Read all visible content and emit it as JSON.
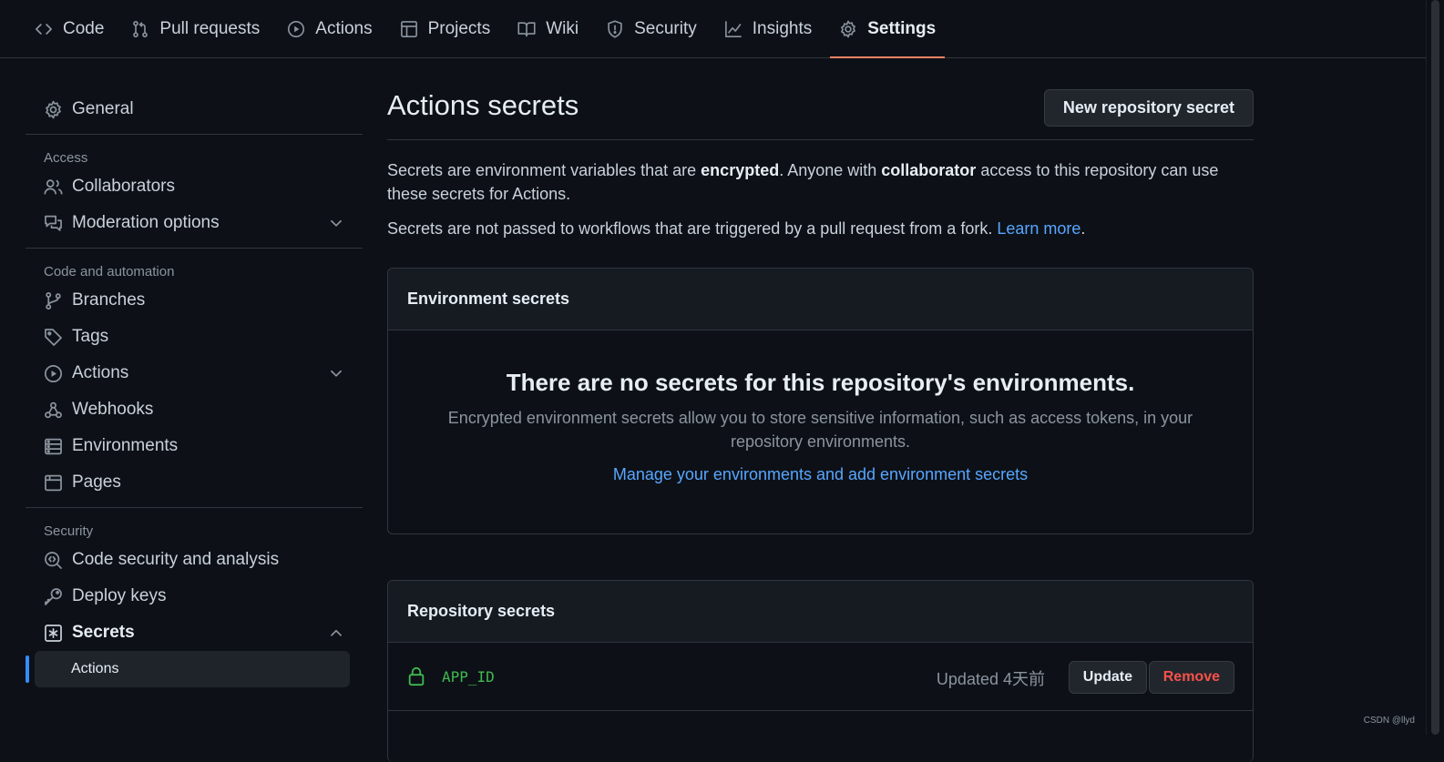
{
  "topnav": {
    "tabs": [
      {
        "label": "Code",
        "icon": "code-icon"
      },
      {
        "label": "Pull requests",
        "icon": "git-pull-request-icon"
      },
      {
        "label": "Actions",
        "icon": "play-circle-icon"
      },
      {
        "label": "Projects",
        "icon": "table-icon"
      },
      {
        "label": "Wiki",
        "icon": "book-icon"
      },
      {
        "label": "Security",
        "icon": "shield-icon"
      },
      {
        "label": "Insights",
        "icon": "graph-icon"
      },
      {
        "label": "Settings",
        "icon": "gear-icon",
        "selected": true
      }
    ]
  },
  "sidebar": {
    "general": "General",
    "access_heading": "Access",
    "collaborators": "Collaborators",
    "moderation": "Moderation options",
    "code_heading": "Code and automation",
    "branches": "Branches",
    "tags": "Tags",
    "actions": "Actions",
    "webhooks": "Webhooks",
    "environments": "Environments",
    "pages": "Pages",
    "security_heading": "Security",
    "code_security": "Code security and analysis",
    "deploy_keys": "Deploy keys",
    "secrets": "Secrets",
    "secrets_actions": "Actions"
  },
  "main": {
    "title": "Actions secrets",
    "new_button": "New repository secret",
    "intro": {
      "t1": "Secrets are environment variables that are ",
      "b1": "encrypted",
      "t2": ". Anyone with ",
      "b2": "collaborator",
      "t3": " access to this repository can use these secrets for Actions."
    },
    "fork_note": "Secrets are not passed to workflows that are triggered by a pull request from a fork. ",
    "learn_more": "Learn more",
    "period": ".",
    "env": {
      "heading": "Environment secrets",
      "blank_title": "There are no secrets for this repository's environments.",
      "blank_desc": "Encrypted environment secrets allow you to store sensitive information, such as access tokens, in your repository environments.",
      "manage_link": "Manage your environments and add environment secrets"
    },
    "repo": {
      "heading": "Repository secrets",
      "secrets": [
        {
          "name": "APP_ID",
          "updated": "Updated 4天前"
        }
      ],
      "update_label": "Update",
      "remove_label": "Remove"
    }
  },
  "watermark": "CSDN @llyd",
  "colors": {
    "background": "#0d1117",
    "selected_tab_underline": "#f78166",
    "link": "#58a6ff",
    "secret_name": "#3fb950",
    "danger": "#f85149",
    "active_indicator": "#388bfd"
  }
}
